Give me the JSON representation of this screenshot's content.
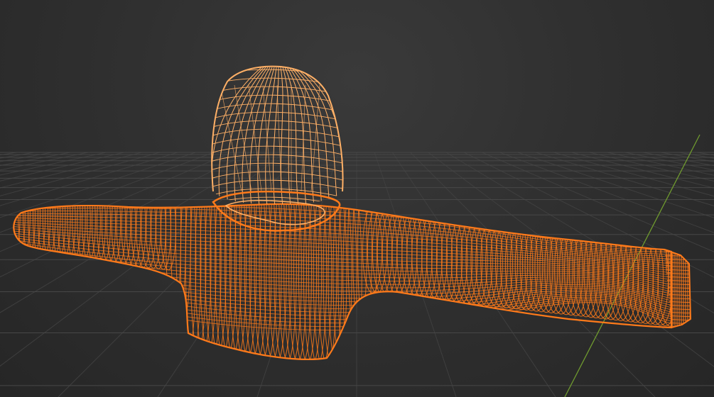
{
  "viewport": {
    "name": "3d-viewport",
    "background": "#2e2e2e"
  },
  "colors": {
    "wire_selected": "#ff7a1a",
    "wire_active": "#ffb066",
    "grid_line": "#3f3f3f",
    "grid_major": "#474747",
    "axis_y": "#6f9a2f"
  },
  "object": {
    "type": "mesh",
    "display": "wireframe",
    "selected": true,
    "shape_icon": "femur-knee-joint-mesh-icon"
  }
}
